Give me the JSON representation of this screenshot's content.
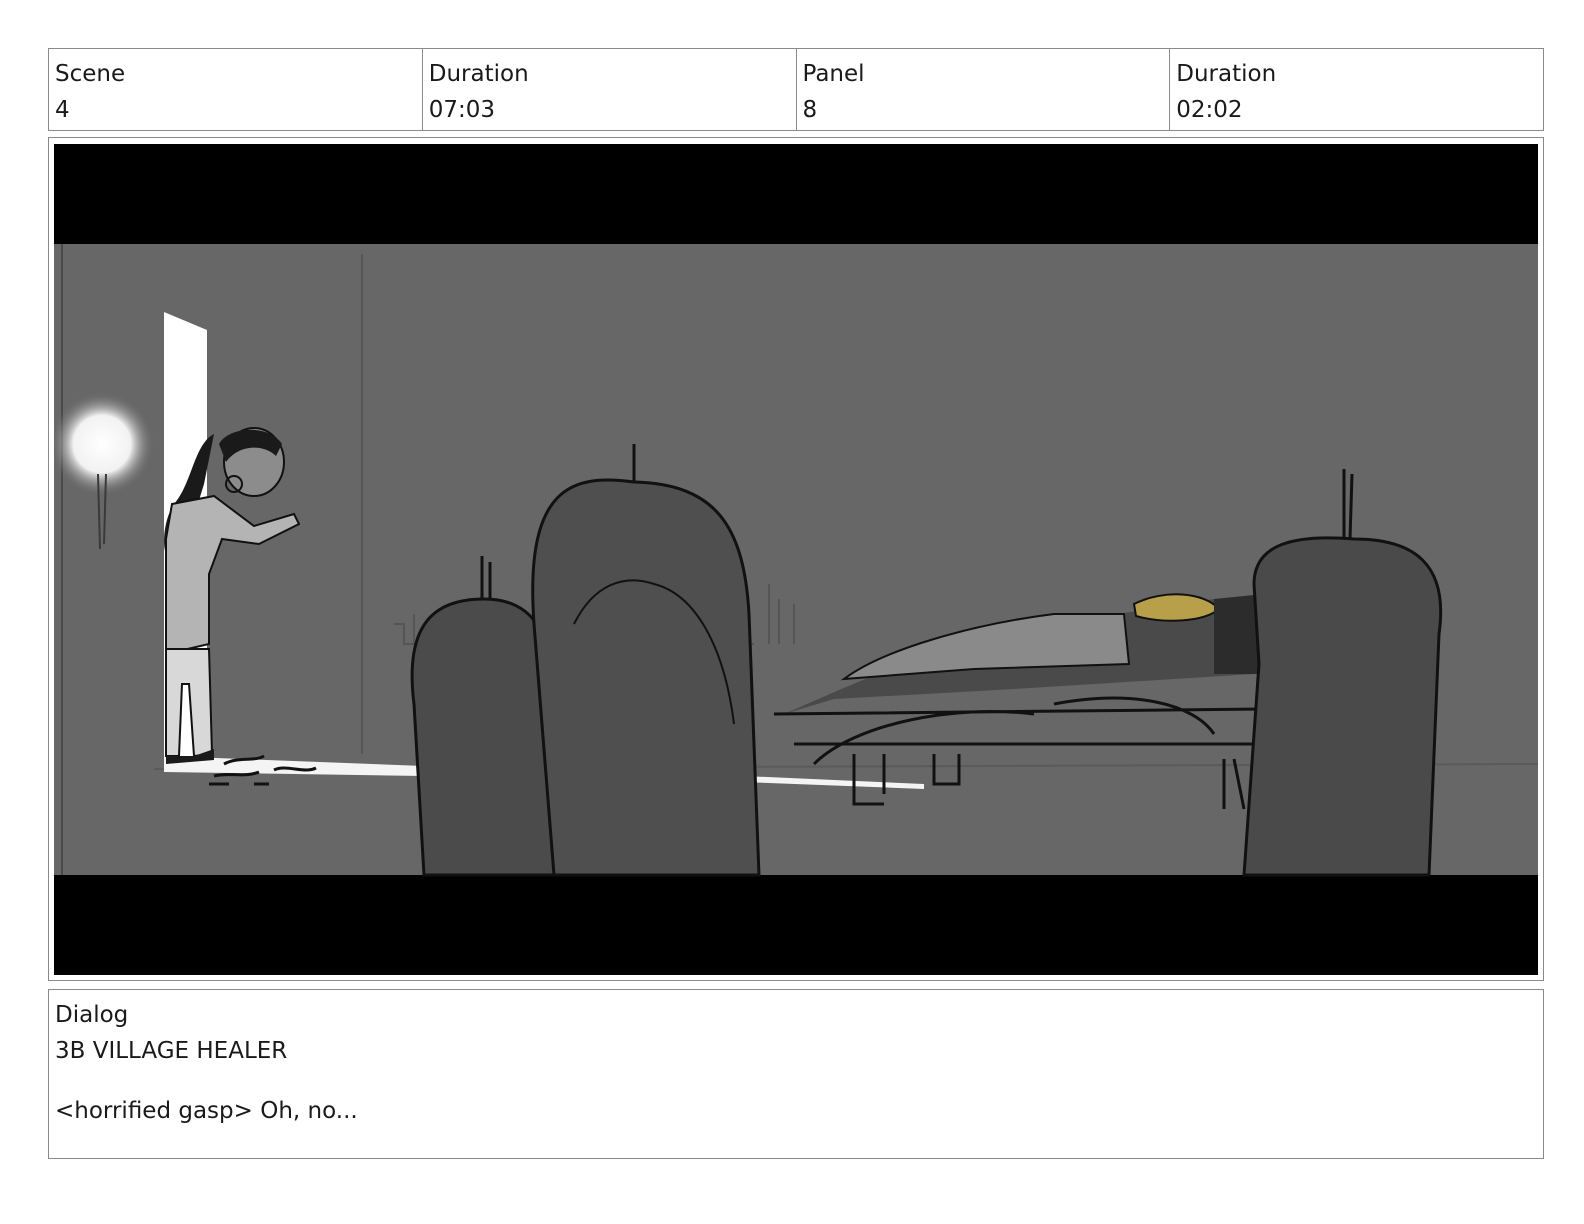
{
  "header": {
    "scene_label": "Scene",
    "scene_value": "4",
    "scene_duration_label": "Duration",
    "scene_duration_value": "07:03",
    "panel_label": "Panel",
    "panel_value": "8",
    "panel_duration_label": "Duration",
    "panel_duration_value": "02:02"
  },
  "dialog": {
    "label": "Dialog",
    "speaker": "3B VILLAGE HEALER",
    "line": "<horrified gasp> Oh, no..."
  }
}
